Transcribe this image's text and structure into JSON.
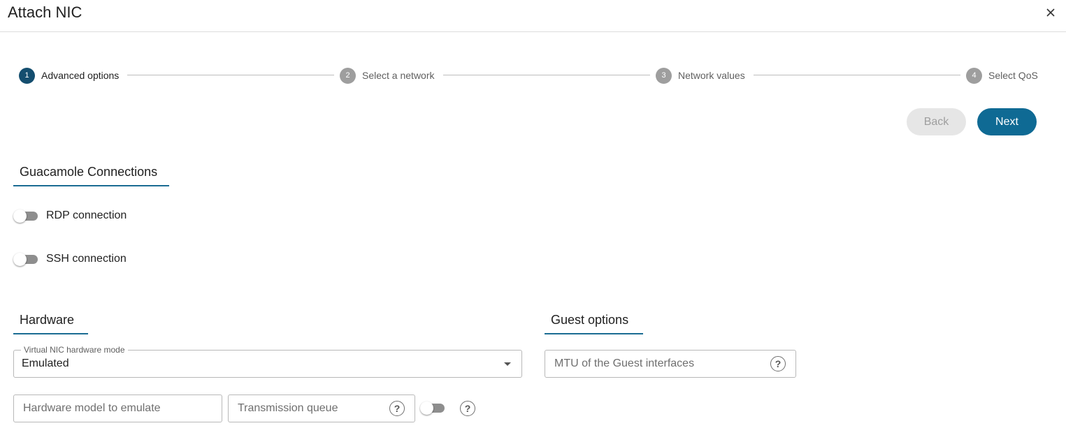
{
  "dialog": {
    "title": "Attach NIC",
    "close_icon": "close-icon"
  },
  "stepper": {
    "steps": [
      {
        "number": "1",
        "label": "Advanced options",
        "active": true
      },
      {
        "number": "2",
        "label": "Select a network",
        "active": false
      },
      {
        "number": "3",
        "label": "Network values",
        "active": false
      },
      {
        "number": "4",
        "label": "Select QoS",
        "active": false
      }
    ]
  },
  "actions": {
    "back_label": "Back",
    "next_label": "Next"
  },
  "guacamole": {
    "title": "Guacamole Connections",
    "rdp_label": "RDP connection",
    "rdp_enabled": false,
    "ssh_label": "SSH connection",
    "ssh_enabled": false
  },
  "hardware": {
    "title": "Hardware",
    "nic_mode_label": "Virtual NIC hardware mode",
    "nic_mode_value": "Emulated",
    "model_placeholder": "Hardware model to emulate",
    "queue_placeholder": "Transmission queue",
    "queue_toggle_enabled": false
  },
  "guest": {
    "title": "Guest options",
    "mtu_placeholder": "MTU of the Guest interfaces"
  },
  "colors": {
    "accent": "#0f6a94",
    "active_step": "#144e6f",
    "inactive_step": "#9e9e9e"
  }
}
